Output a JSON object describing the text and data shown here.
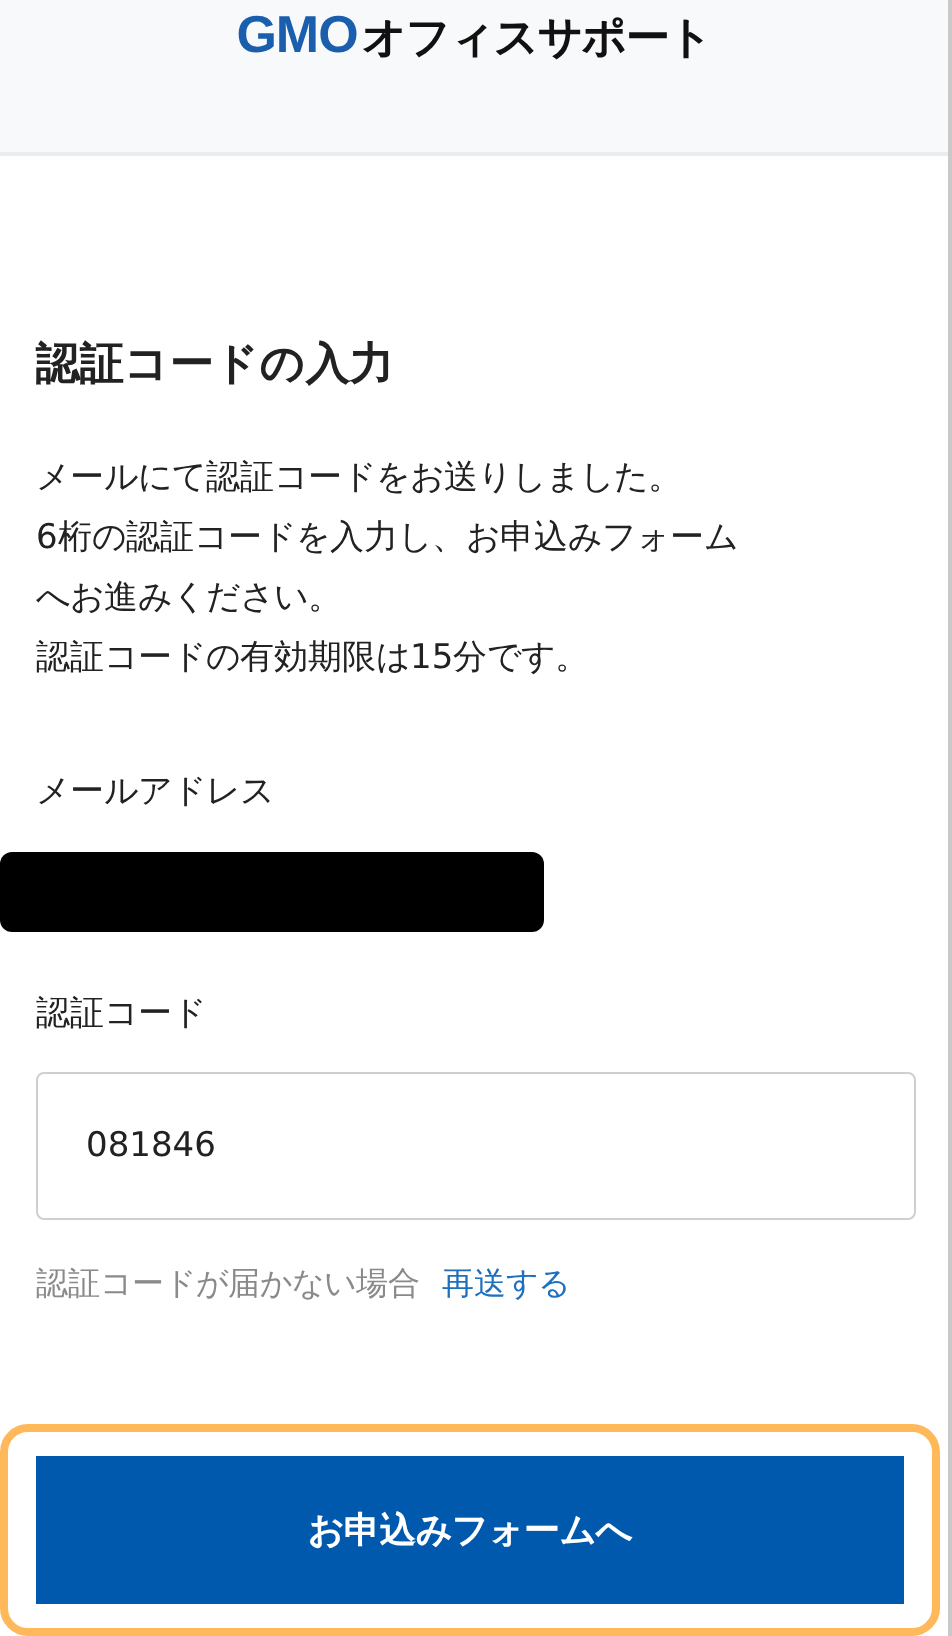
{
  "header": {
    "logo_brand": "GMO",
    "logo_service": "オフィスサポート"
  },
  "title": "認証コードの入力",
  "description": [
    "メールにて認証コードをお送りしました。",
    "6桁の認証コードを入力し、お申込みフォーム",
    "へお進みください。",
    "認証コードの有効期限は15分です。"
  ],
  "email": {
    "label": "メールアドレス",
    "redacted": true
  },
  "code": {
    "label": "認証コード",
    "value": "081846"
  },
  "resend": {
    "text": "認証コードが届かない場合",
    "link": "再送する"
  },
  "submit": {
    "label": "お申込みフォームへ",
    "focused": true
  }
}
